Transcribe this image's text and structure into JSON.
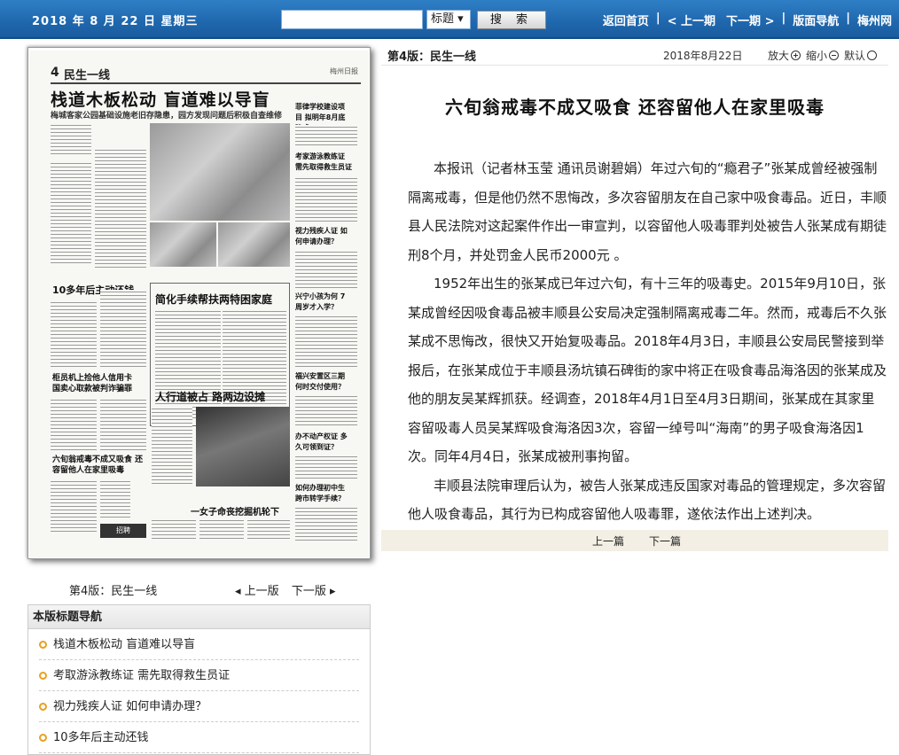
{
  "topbar": {
    "date": "2018 年 8 月 22 日   星期三",
    "search_placeholder": "",
    "search_type": "标题 ▾",
    "search_button": "搜 索",
    "nav": [
      "返回首页",
      "< 上一期",
      "下一期 >",
      "版面导航",
      "梅州网"
    ]
  },
  "thumbnail": {
    "page_num": "4",
    "section": "民生一线",
    "logo": "梅州日报",
    "headline": "栈道木板松动 盲道难以导盲",
    "subhead": "梅城客家公园基础设施老旧存隐患，园方发现问题后积极自查维修",
    "h_left1": "10多年后主动还钱",
    "h_mid1": "简化手续帮扶两特困家庭",
    "h_left2": "柜员机上捡他人信用卡 国卖心取款被判诈骗罪",
    "h_mid2": "人行道被占 路两边设摊",
    "h_left3": "六旬翁戒毒不成又吸食 还容留他人在家里吸毒",
    "h_bottom": "一女子命丧挖掘机轮下",
    "r1": "考家游泳教练证 需先取得救生员证",
    "r2": "视力残疾人证 如何申请办理？",
    "r3": "兴宁小孩为何 7周岁才入学？",
    "r4": "福兴安置区三期 何时交付使用？",
    "r5": "办不动产权证 多久可领到证？",
    "r6": "如何办理初中生 跨市转学手续？",
    "r0": "菲律学校建设项目 拟明年8月底建成",
    "ad": "招聘"
  },
  "below_thumb": {
    "page_label": "第4版：民生一线",
    "prev": "◂ 上一版",
    "next": "下一版 ▸"
  },
  "navbox": {
    "title": "本版标题导航",
    "items": [
      "栈道木板松动 盲道难以导盲",
      "考取游泳教练证 需先取得救生员证",
      "视力残疾人证 如何申请办理？",
      "10多年后主动还钱"
    ]
  },
  "meta": {
    "page": "第4版：民生一线",
    "date": "2018年8月22日",
    "zoom_in": "放大",
    "zoom_out": "缩小",
    "zoom_default": "默认"
  },
  "article": {
    "title": "六旬翁戒毒不成又吸食 还容留他人在家里吸毒",
    "paragraphs": [
      "本报讯（记者林玉莹 通讯员谢碧娟）年过六旬的“瘾君子”张某成曾经被强制隔离戒毒，但是他仍然不思悔改，多次容留朋友在自己家中吸食毒品。近日，丰顺县人民法院对这起案件作出一审宣判，以容留他人吸毒罪判处被告人张某成有期徒刑8个月，并处罚金人民币2000元 。",
      "1952年出生的张某成已年过六旬，有十三年的吸毒史。2015年9月10日，张某成曾经因吸食毒品被丰顺县公安局决定强制隔离戒毒二年。然而，戒毒后不久张某成不思悔改，很快又开始复吸毒品。2018年4月3日，丰顺县公安局民警接到举报后，在张某成位于丰顺县汤坑镇石碑街的家中将正在吸食毒品海洛因的张某成及他的朋友吴某辉抓获。经调查，2018年4月1日至4月3日期间，张某成在其家里容留吸毒人员吴某辉吸食海洛因3次，容留一绰号叫“海南”的男子吸食海洛因1次。同年4月4日，张某成被刑事拘留。",
      "丰顺县法院审理后认为，被告人张某成违反国家对毒品的管理规定，多次容留他人吸食毒品，其行为已构成容留他人吸毒罪，遂依法作出上述判决。"
    ]
  },
  "pager": {
    "prev": "上一篇",
    "next": "下一篇"
  }
}
